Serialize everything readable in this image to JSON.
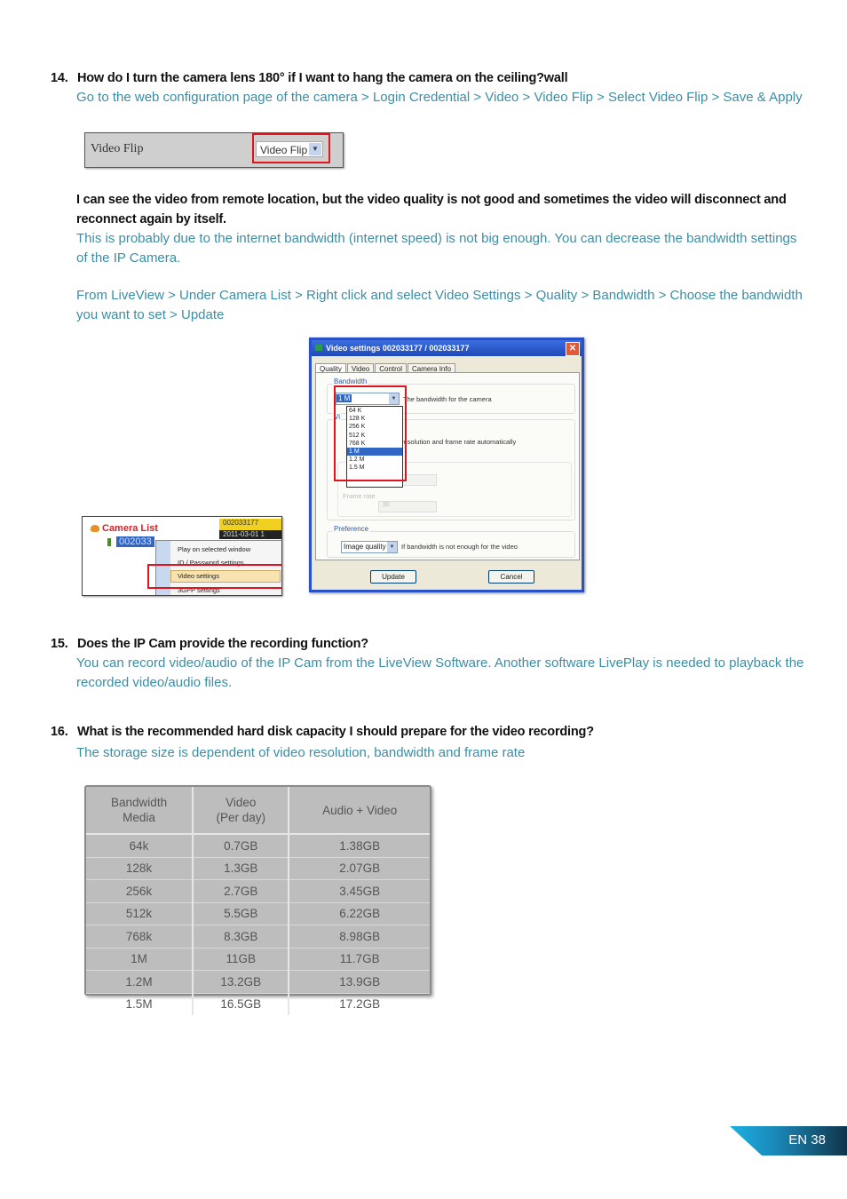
{
  "q14": {
    "number": "14.",
    "question": "How do I turn the camera lens 180° if I want to hang the camera on the ceiling?wall",
    "answer": "Go to the web configuration page of the camera > Login Credential > Video > Video Flip > Select Video Flip > Save & Apply",
    "screenshot": {
      "label": "Video Flip",
      "select_value": "Video Flip"
    },
    "sub_question": "I can see the video from remote location, but the video quality is not good and sometimes the video will disconnect and reconnect again by itself.",
    "sub_answer_1": "This is probably due to the internet bandwidth (internet speed) is not big enough. You can decrease the bandwidth settings of the IP Camera.",
    "sub_answer_2": "From LiveView > Under Camera List > Right click and select Video Settings > Quality > Bandwidth > Choose the bandwidth you want to set > Update"
  },
  "camera_list": {
    "title": "Camera List",
    "node": "002033",
    "yellow_tag": "002033177",
    "date_tag": "2011-03-01 1",
    "menu": [
      "Play on selected window",
      "ID / Password settings",
      "Video settings",
      "3GPP settings"
    ],
    "highlighted": "Video settings"
  },
  "video_settings": {
    "title": "Video settings   002033177 / 002033177",
    "tabs": [
      "Quality",
      "Video",
      "Control",
      "Camera Info"
    ],
    "bandwidth_caption": "Bandwidth",
    "bandwidth_value": "1 M",
    "bandwidth_desc": "The bandwidth for the camera",
    "options": [
      "64 K",
      "128 K",
      "256 K",
      "512 K",
      "768 K",
      "1 M",
      "1.2 M",
      "1.5 M"
    ],
    "selected_option": "1 M",
    "video_caption": "Vi",
    "auto_text": "resolution and frame rate automatically",
    "frame_rate_label": "Frame rate",
    "frame_rate_value": "30",
    "preference_caption": "Preference",
    "preference_value": "Image quality",
    "preference_desc": "If bandwidth is not enough for the video",
    "update_label": "Update",
    "cancel_label": "Cancel"
  },
  "q15": {
    "number": "15.",
    "question": "Does the IP Cam provide the recording function?",
    "answer": "You can record video/audio of the IP Cam from the LiveView Software. Another software LivePlay is needed to playback the recorded video/audio files."
  },
  "q16": {
    "number": "16.",
    "question": "What is the recommended hard disk capacity I should prepare for the video recording?",
    "answer": "The storage size is dependent of video resolution, bandwidth and frame rate"
  },
  "storage_table": {
    "headers": [
      "Bandwidth\nMedia",
      "Video\n(Per day)",
      "Audio + Video"
    ],
    "rows": [
      [
        "64k",
        "0.7GB",
        "1.38GB"
      ],
      [
        "128k",
        "1.3GB",
        "2.07GB"
      ],
      [
        "256k",
        "2.7GB",
        "3.45GB"
      ],
      [
        "512k",
        "5.5GB",
        "6.22GB"
      ],
      [
        "768k",
        "8.3GB",
        "8.98GB"
      ],
      [
        "1M",
        "11GB",
        "11.7GB"
      ],
      [
        "1.2M",
        "13.2GB",
        "13.9GB"
      ],
      [
        "1.5M",
        "16.5GB",
        "17.2GB"
      ]
    ]
  },
  "footer": {
    "page_label": "EN 38"
  }
}
